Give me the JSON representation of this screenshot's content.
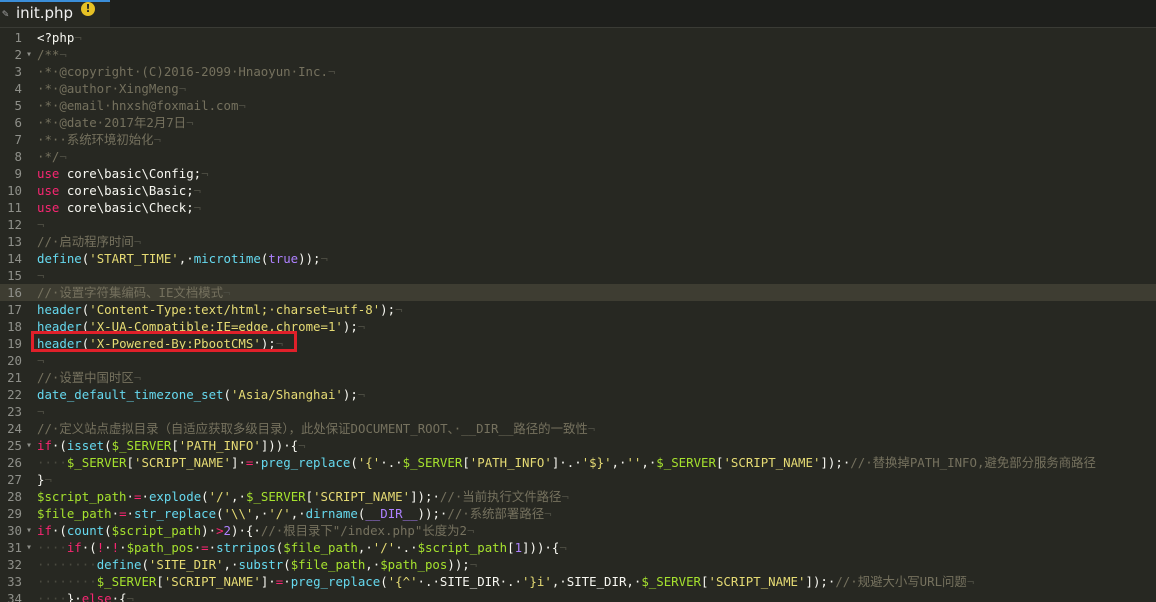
{
  "tab": {
    "filename": "init.php",
    "warning_symbol": "!"
  },
  "lines": [
    {
      "n": "1",
      "fold": "",
      "active": false,
      "segs": [
        {
          "c": "pl",
          "t": "<?php"
        },
        {
          "c": "ws",
          "t": "¬"
        }
      ]
    },
    {
      "n": "2",
      "fold": "▾",
      "active": false,
      "segs": [
        {
          "c": "cm",
          "t": "/**"
        },
        {
          "c": "ws",
          "t": "¬"
        }
      ]
    },
    {
      "n": "3",
      "fold": "",
      "active": false,
      "segs": [
        {
          "c": "cm",
          "t": "·*·@copyright·(C)2016-2099·Hnaoyun·Inc."
        },
        {
          "c": "ws",
          "t": "¬"
        }
      ]
    },
    {
      "n": "4",
      "fold": "",
      "active": false,
      "segs": [
        {
          "c": "cm",
          "t": "·*·@author·XingMeng"
        },
        {
          "c": "ws",
          "t": "¬"
        }
      ]
    },
    {
      "n": "5",
      "fold": "",
      "active": false,
      "segs": [
        {
          "c": "cm",
          "t": "·*·@email·hnxsh@foxmail.com"
        },
        {
          "c": "ws",
          "t": "¬"
        }
      ]
    },
    {
      "n": "6",
      "fold": "",
      "active": false,
      "segs": [
        {
          "c": "cm",
          "t": "·*·@date·2017年2月7日"
        },
        {
          "c": "ws",
          "t": "¬"
        }
      ]
    },
    {
      "n": "7",
      "fold": "",
      "active": false,
      "segs": [
        {
          "c": "cm",
          "t": "·*··系统环境初始化"
        },
        {
          "c": "ws",
          "t": "¬"
        }
      ]
    },
    {
      "n": "8",
      "fold": "",
      "active": false,
      "segs": [
        {
          "c": "cm",
          "t": "·*/"
        },
        {
          "c": "ws",
          "t": "¬"
        }
      ]
    },
    {
      "n": "9",
      "fold": "",
      "active": false,
      "segs": [
        {
          "c": "kw",
          "t": "use"
        },
        {
          "c": "pl",
          "t": " core\\basic\\Config;"
        },
        {
          "c": "ws",
          "t": "¬"
        }
      ]
    },
    {
      "n": "10",
      "fold": "",
      "active": false,
      "segs": [
        {
          "c": "kw",
          "t": "use"
        },
        {
          "c": "pl",
          "t": " core\\basic\\Basic;"
        },
        {
          "c": "ws",
          "t": "¬"
        }
      ]
    },
    {
      "n": "11",
      "fold": "",
      "active": false,
      "segs": [
        {
          "c": "kw",
          "t": "use"
        },
        {
          "c": "pl",
          "t": " core\\basic\\Check;"
        },
        {
          "c": "ws",
          "t": "¬"
        }
      ]
    },
    {
      "n": "12",
      "fold": "",
      "active": false,
      "segs": [
        {
          "c": "ws",
          "t": "¬"
        }
      ]
    },
    {
      "n": "13",
      "fold": "",
      "active": false,
      "segs": [
        {
          "c": "cm",
          "t": "//·启动程序时间"
        },
        {
          "c": "ws",
          "t": "¬"
        }
      ]
    },
    {
      "n": "14",
      "fold": "",
      "active": false,
      "segs": [
        {
          "c": "fn",
          "t": "define"
        },
        {
          "c": "pl",
          "t": "("
        },
        {
          "c": "str",
          "t": "'START_TIME'"
        },
        {
          "c": "pl",
          "t": ",·"
        },
        {
          "c": "fn",
          "t": "microtime"
        },
        {
          "c": "pl",
          "t": "("
        },
        {
          "c": "num",
          "t": "true"
        },
        {
          "c": "pl",
          "t": "));"
        },
        {
          "c": "ws",
          "t": "¬"
        }
      ]
    },
    {
      "n": "15",
      "fold": "",
      "active": false,
      "segs": [
        {
          "c": "ws",
          "t": "¬"
        }
      ]
    },
    {
      "n": "16",
      "fold": "",
      "active": true,
      "segs": [
        {
          "c": "cm",
          "t": "//·设置字符集编码、IE文档模式"
        },
        {
          "c": "ws",
          "t": "¬"
        }
      ]
    },
    {
      "n": "17",
      "fold": "",
      "active": false,
      "segs": [
        {
          "c": "fn",
          "t": "header"
        },
        {
          "c": "pl",
          "t": "("
        },
        {
          "c": "str",
          "t": "'Content-Type:text/html;·charset=utf-8'"
        },
        {
          "c": "pl",
          "t": ");"
        },
        {
          "c": "ws",
          "t": "¬"
        }
      ]
    },
    {
      "n": "18",
      "fold": "",
      "active": false,
      "segs": [
        {
          "c": "fn",
          "t": "header"
        },
        {
          "c": "pl",
          "t": "("
        },
        {
          "c": "str",
          "t": "'X-UA-Compatible:IE=edge,chrome=1'"
        },
        {
          "c": "pl",
          "t": ");"
        },
        {
          "c": "ws",
          "t": "¬"
        }
      ]
    },
    {
      "n": "19",
      "fold": "",
      "active": false,
      "segs": [
        {
          "c": "fn",
          "t": "header"
        },
        {
          "c": "pl",
          "t": "("
        },
        {
          "c": "str",
          "t": "'X-Powered-By:PbootCMS'"
        },
        {
          "c": "pl",
          "t": ");"
        },
        {
          "c": "ws",
          "t": "¬"
        }
      ]
    },
    {
      "n": "20",
      "fold": "",
      "active": false,
      "segs": [
        {
          "c": "ws",
          "t": "¬"
        }
      ]
    },
    {
      "n": "21",
      "fold": "",
      "active": false,
      "segs": [
        {
          "c": "cm",
          "t": "//·设置中国时区"
        },
        {
          "c": "ws",
          "t": "¬"
        }
      ]
    },
    {
      "n": "22",
      "fold": "",
      "active": false,
      "segs": [
        {
          "c": "fn",
          "t": "date_default_timezone_set"
        },
        {
          "c": "pl",
          "t": "("
        },
        {
          "c": "str",
          "t": "'Asia/Shanghai'"
        },
        {
          "c": "pl",
          "t": ");"
        },
        {
          "c": "ws",
          "t": "¬"
        }
      ]
    },
    {
      "n": "23",
      "fold": "",
      "active": false,
      "segs": [
        {
          "c": "ws",
          "t": "¬"
        }
      ]
    },
    {
      "n": "24",
      "fold": "",
      "active": false,
      "segs": [
        {
          "c": "cm",
          "t": "//·定义站点虚拟目录（自适应获取多级目录），此处保证DOCUMENT_ROOT、·__DIR__路径的一致性"
        },
        {
          "c": "ws",
          "t": "¬"
        }
      ]
    },
    {
      "n": "25",
      "fold": "▾",
      "active": false,
      "segs": [
        {
          "c": "kw",
          "t": "if"
        },
        {
          "c": "pl",
          "t": "·("
        },
        {
          "c": "fn",
          "t": "isset"
        },
        {
          "c": "pl",
          "t": "("
        },
        {
          "c": "var",
          "t": "$_SERVER"
        },
        {
          "c": "pl",
          "t": "["
        },
        {
          "c": "str",
          "t": "'PATH_INFO'"
        },
        {
          "c": "pl",
          "t": "]))·{"
        },
        {
          "c": "ws",
          "t": "¬"
        }
      ]
    },
    {
      "n": "26",
      "fold": "",
      "active": false,
      "segs": [
        {
          "c": "ws",
          "t": "····"
        },
        {
          "c": "var",
          "t": "$_SERVER"
        },
        {
          "c": "pl",
          "t": "["
        },
        {
          "c": "str",
          "t": "'SCRIPT_NAME'"
        },
        {
          "c": "pl",
          "t": "]·"
        },
        {
          "c": "op",
          "t": "="
        },
        {
          "c": "pl",
          "t": "·"
        },
        {
          "c": "fn",
          "t": "preg_replace"
        },
        {
          "c": "pl",
          "t": "("
        },
        {
          "c": "str",
          "t": "'{'"
        },
        {
          "c": "pl",
          "t": "·.·"
        },
        {
          "c": "var",
          "t": "$_SERVER"
        },
        {
          "c": "pl",
          "t": "["
        },
        {
          "c": "str",
          "t": "'PATH_INFO'"
        },
        {
          "c": "pl",
          "t": "]·.·"
        },
        {
          "c": "str",
          "t": "'$}'"
        },
        {
          "c": "pl",
          "t": ",·"
        },
        {
          "c": "str",
          "t": "''"
        },
        {
          "c": "pl",
          "t": ",·"
        },
        {
          "c": "var",
          "t": "$_SERVER"
        },
        {
          "c": "pl",
          "t": "["
        },
        {
          "c": "str",
          "t": "'SCRIPT_NAME'"
        },
        {
          "c": "pl",
          "t": "]);·"
        },
        {
          "c": "cm",
          "t": "//·替换掉PATH_INFO,避免部分服务商路径"
        }
      ]
    },
    {
      "n": "27",
      "fold": "",
      "active": false,
      "segs": [
        {
          "c": "pl",
          "t": "}"
        },
        {
          "c": "ws",
          "t": "¬"
        }
      ]
    },
    {
      "n": "28",
      "fold": "",
      "active": false,
      "segs": [
        {
          "c": "var",
          "t": "$script_path"
        },
        {
          "c": "pl",
          "t": "·"
        },
        {
          "c": "op",
          "t": "="
        },
        {
          "c": "pl",
          "t": "·"
        },
        {
          "c": "fn",
          "t": "explode"
        },
        {
          "c": "pl",
          "t": "("
        },
        {
          "c": "str",
          "t": "'/'"
        },
        {
          "c": "pl",
          "t": ",·"
        },
        {
          "c": "var",
          "t": "$_SERVER"
        },
        {
          "c": "pl",
          "t": "["
        },
        {
          "c": "str",
          "t": "'SCRIPT_NAME'"
        },
        {
          "c": "pl",
          "t": "]);·"
        },
        {
          "c": "cm",
          "t": "//·当前执行文件路径"
        },
        {
          "c": "ws",
          "t": "¬"
        }
      ]
    },
    {
      "n": "29",
      "fold": "",
      "active": false,
      "segs": [
        {
          "c": "var",
          "t": "$file_path"
        },
        {
          "c": "pl",
          "t": "·"
        },
        {
          "c": "op",
          "t": "="
        },
        {
          "c": "pl",
          "t": "·"
        },
        {
          "c": "fn",
          "t": "str_replace"
        },
        {
          "c": "pl",
          "t": "("
        },
        {
          "c": "str",
          "t": "'\\\\'"
        },
        {
          "c": "pl",
          "t": ",·"
        },
        {
          "c": "str",
          "t": "'/'"
        },
        {
          "c": "pl",
          "t": ",·"
        },
        {
          "c": "fn",
          "t": "dirname"
        },
        {
          "c": "pl",
          "t": "("
        },
        {
          "c": "num",
          "t": "__DIR__"
        },
        {
          "c": "pl",
          "t": "));·"
        },
        {
          "c": "cm",
          "t": "//·系统部署路径"
        },
        {
          "c": "ws",
          "t": "¬"
        }
      ]
    },
    {
      "n": "30",
      "fold": "▾",
      "active": false,
      "segs": [
        {
          "c": "kw",
          "t": "if"
        },
        {
          "c": "pl",
          "t": "·("
        },
        {
          "c": "fn",
          "t": "count"
        },
        {
          "c": "pl",
          "t": "("
        },
        {
          "c": "var",
          "t": "$script_path"
        },
        {
          "c": "pl",
          "t": ")·"
        },
        {
          "c": "op",
          "t": ">"
        },
        {
          "c": "num",
          "t": "2"
        },
        {
          "c": "pl",
          "t": ")·{·"
        },
        {
          "c": "cm",
          "t": "//·根目录下\"/index.php\"长度为2"
        },
        {
          "c": "ws",
          "t": "¬"
        }
      ]
    },
    {
      "n": "31",
      "fold": "▾",
      "active": false,
      "segs": [
        {
          "c": "ws",
          "t": "····"
        },
        {
          "c": "kw",
          "t": "if"
        },
        {
          "c": "pl",
          "t": "·("
        },
        {
          "c": "op",
          "t": "!"
        },
        {
          "c": "pl",
          "t": "·"
        },
        {
          "c": "op",
          "t": "!"
        },
        {
          "c": "pl",
          "t": "·"
        },
        {
          "c": "var",
          "t": "$path_pos"
        },
        {
          "c": "pl",
          "t": "·"
        },
        {
          "c": "op",
          "t": "="
        },
        {
          "c": "pl",
          "t": "·"
        },
        {
          "c": "fn",
          "t": "strripos"
        },
        {
          "c": "pl",
          "t": "("
        },
        {
          "c": "var",
          "t": "$file_path"
        },
        {
          "c": "pl",
          "t": ",·"
        },
        {
          "c": "str",
          "t": "'/'"
        },
        {
          "c": "pl",
          "t": "·.·"
        },
        {
          "c": "var",
          "t": "$script_path"
        },
        {
          "c": "pl",
          "t": "["
        },
        {
          "c": "num",
          "t": "1"
        },
        {
          "c": "pl",
          "t": "]))·{"
        },
        {
          "c": "ws",
          "t": "¬"
        }
      ]
    },
    {
      "n": "32",
      "fold": "",
      "active": false,
      "segs": [
        {
          "c": "ws",
          "t": "········"
        },
        {
          "c": "fn",
          "t": "define"
        },
        {
          "c": "pl",
          "t": "("
        },
        {
          "c": "str",
          "t": "'SITE_DIR'"
        },
        {
          "c": "pl",
          "t": ",·"
        },
        {
          "c": "fn",
          "t": "substr"
        },
        {
          "c": "pl",
          "t": "("
        },
        {
          "c": "var",
          "t": "$file_path"
        },
        {
          "c": "pl",
          "t": ",·"
        },
        {
          "c": "var",
          "t": "$path_pos"
        },
        {
          "c": "pl",
          "t": "));"
        },
        {
          "c": "ws",
          "t": "¬"
        }
      ]
    },
    {
      "n": "33",
      "fold": "",
      "active": false,
      "segs": [
        {
          "c": "ws",
          "t": "········"
        },
        {
          "c": "var",
          "t": "$_SERVER"
        },
        {
          "c": "pl",
          "t": "["
        },
        {
          "c": "str",
          "t": "'SCRIPT_NAME'"
        },
        {
          "c": "pl",
          "t": "]·"
        },
        {
          "c": "op",
          "t": "="
        },
        {
          "c": "pl",
          "t": "·"
        },
        {
          "c": "fn",
          "t": "preg_replace"
        },
        {
          "c": "pl",
          "t": "("
        },
        {
          "c": "str",
          "t": "'{^'"
        },
        {
          "c": "pl",
          "t": "·.·SITE_DIR·.·"
        },
        {
          "c": "str",
          "t": "'}i'"
        },
        {
          "c": "pl",
          "t": ",·SITE_DIR,·"
        },
        {
          "c": "var",
          "t": "$_SERVER"
        },
        {
          "c": "pl",
          "t": "["
        },
        {
          "c": "str",
          "t": "'SCRIPT_NAME'"
        },
        {
          "c": "pl",
          "t": "]);·"
        },
        {
          "c": "cm",
          "t": "//·规避大小写URL问题"
        },
        {
          "c": "ws",
          "t": "¬"
        }
      ]
    },
    {
      "n": "34",
      "fold": "",
      "active": false,
      "segs": [
        {
          "c": "ws",
          "t": "····"
        },
        {
          "c": "pl",
          "t": "}·"
        },
        {
          "c": "kw",
          "t": "else"
        },
        {
          "c": "pl",
          "t": "·{"
        },
        {
          "c": "ws",
          "t": "¬"
        }
      ]
    }
  ]
}
